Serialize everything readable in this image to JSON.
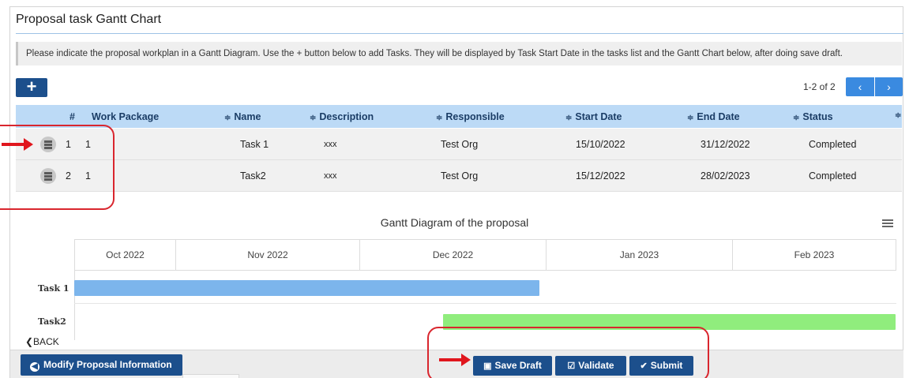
{
  "page": {
    "title": "Proposal task Gantt Chart",
    "info_text": "Please indicate the proposal workplan in a Gantt Diagram. Use the + button below to add Tasks. They will be displayed by Task Start Date in the tasks list and the Gantt Chart below, after doing save draft."
  },
  "toolbar": {
    "add_label": "+",
    "pager_text": "1-2 of 2",
    "prev_label": "‹",
    "next_label": "›"
  },
  "table": {
    "headers": [
      "#",
      "Work Package",
      "Name",
      "Description",
      "Responsible",
      "Start Date",
      "End Date",
      "Status"
    ],
    "sort_glyph": "≑",
    "rows": [
      [
        "1",
        "1",
        "Task 1",
        "xxx",
        "Test Org",
        "15/10/2022",
        "31/12/2022",
        "Completed"
      ],
      [
        "2",
        "1",
        "Task2",
        "xxx",
        "Test Org",
        "15/12/2022",
        "28/02/2023",
        "Completed"
      ]
    ]
  },
  "gantt": {
    "title": "Gantt Diagram of the proposal",
    "months": [
      "Oct 2022",
      "Nov 2022",
      "Dec 2022",
      "Jan 2023",
      "Feb 2023"
    ],
    "tasks": [
      {
        "label": "Task 1",
        "start": "15/10/2022",
        "end": "31/12/2022",
        "color": "#7cb5ec"
      },
      {
        "label": "Task2",
        "start": "15/12/2022",
        "end": "28/02/2023",
        "color": "#90ed7d"
      }
    ]
  },
  "footer": {
    "back_label": "❮BACK",
    "modify_label": "Modify Proposal Information",
    "save_draft_label": "Save Draft",
    "validate_label": "Validate",
    "submit_label": "Submit"
  },
  "colors": {
    "primary_button": "#1c4f8c",
    "pager_button": "#3a8ae0",
    "header_bg": "#bcdaf6",
    "annotation_red": "#d9262e"
  }
}
